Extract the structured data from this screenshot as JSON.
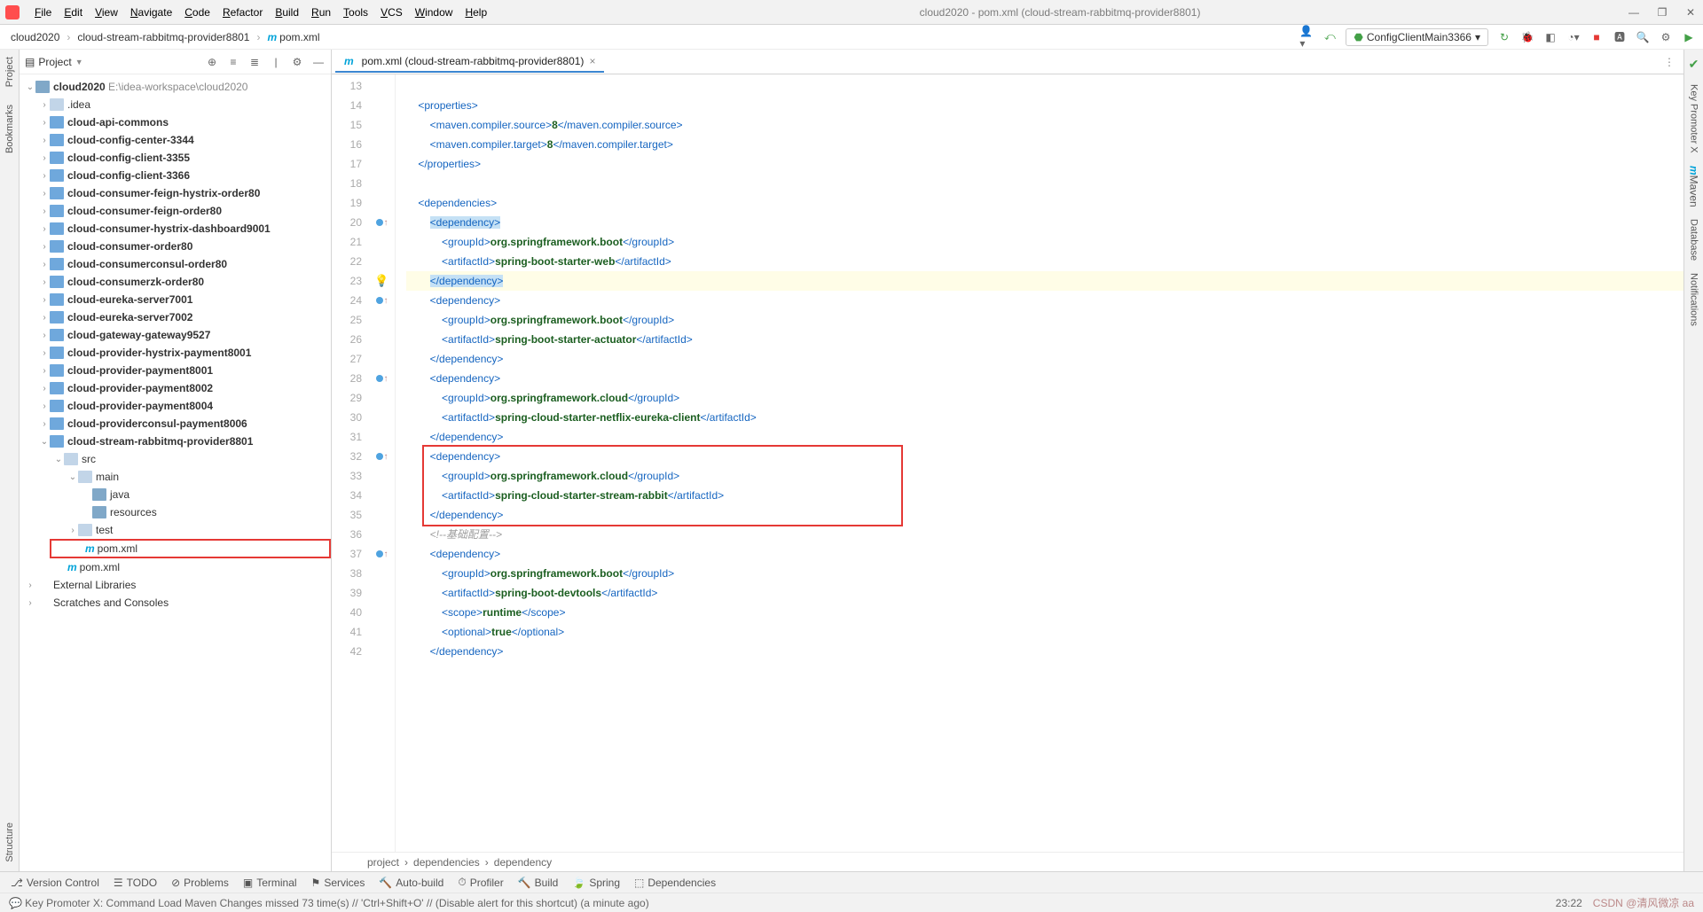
{
  "window": {
    "title": "cloud2020 - pom.xml (cloud-stream-rabbitmq-provider8801)"
  },
  "menu": [
    "File",
    "Edit",
    "View",
    "Navigate",
    "Code",
    "Refactor",
    "Build",
    "Run",
    "Tools",
    "VCS",
    "Window",
    "Help"
  ],
  "crumbs": [
    "cloud2020",
    "cloud-stream-rabbitmq-provider8801",
    "pom.xml"
  ],
  "run_config": "ConfigClientMain3366",
  "proj_header": "Project",
  "tree": {
    "root_name": "cloud2020",
    "root_path": "E:\\idea-workspace\\cloud2020",
    "idea_folder": ".idea",
    "modules": [
      "cloud-api-commons",
      "cloud-config-center-3344",
      "cloud-config-client-3355",
      "cloud-config-client-3366",
      "cloud-consumer-feign-hystrix-order80",
      "cloud-consumer-feign-order80",
      "cloud-consumer-hystrix-dashboard9001",
      "cloud-consumer-order80",
      "cloud-consumerconsul-order80",
      "cloud-consumerzk-order80",
      "cloud-eureka-server7001",
      "cloud-eureka-server7002",
      "cloud-gateway-gateway9527",
      "cloud-provider-hystrix-payment8001",
      "cloud-provider-payment8001",
      "cloud-provider-payment8002",
      "cloud-provider-payment8004",
      "cloud-providerconsul-payment8006"
    ],
    "open_module": "cloud-stream-rabbitmq-provider8801",
    "src": "src",
    "main": "main",
    "java": "java",
    "resources": "resources",
    "test": "test",
    "pom": "pom.xml",
    "root_pom": "pom.xml",
    "ext_lib": "External Libraries",
    "scratches": "Scratches and Consoles"
  },
  "tab": {
    "label": "pom.xml (cloud-stream-rabbitmq-provider8801)"
  },
  "lines": {
    "start": 13,
    "rows": [
      {
        "n": "13",
        "html": ""
      },
      {
        "n": "14",
        "html": "    <span class='tag'>&lt;properties&gt;</span>"
      },
      {
        "n": "15",
        "html": "        <span class='tag'>&lt;maven.compiler.source&gt;</span><span class='txt'>8</span><span class='tag'>&lt;/maven.compiler.source&gt;</span>"
      },
      {
        "n": "16",
        "html": "        <span class='tag'>&lt;maven.compiler.target&gt;</span><span class='txt'>8</span><span class='tag'>&lt;/maven.compiler.target&gt;</span>"
      },
      {
        "n": "17",
        "html": "    <span class='tag'>&lt;/properties&gt;</span>"
      },
      {
        "n": "18",
        "html": ""
      },
      {
        "n": "19",
        "html": "    <span class='tag'>&lt;dependencies&gt;</span>"
      },
      {
        "n": "20",
        "html": "        <span class='tag hl-sel'>&lt;dependency&gt;</span>",
        "mark": "cu"
      },
      {
        "n": "21",
        "html": "            <span class='tag'>&lt;groupId&gt;</span><span class='txt'>org.springframework.boot</span><span class='tag'>&lt;/groupId&gt;</span>"
      },
      {
        "n": "22",
        "html": "            <span class='tag'>&lt;artifactId&gt;</span><span class='txt'>spring-boot-starter-web</span><span class='tag'>&lt;/artifactId&gt;</span>"
      },
      {
        "n": "23",
        "html": "        <span class='tag hl-sel'>&lt;/dependency&gt;</span>",
        "hl": true,
        "mark": "bulb"
      },
      {
        "n": "24",
        "html": "        <span class='tag'>&lt;dependency&gt;</span>",
        "mark": "cu"
      },
      {
        "n": "25",
        "html": "            <span class='tag'>&lt;groupId&gt;</span><span class='txt'>org.springframework.boot</span><span class='tag'>&lt;/groupId&gt;</span>"
      },
      {
        "n": "26",
        "html": "            <span class='tag'>&lt;artifactId&gt;</span><span class='txt'>spring-boot-starter-actuator</span><span class='tag'>&lt;/artifactId&gt;</span>"
      },
      {
        "n": "27",
        "html": "        <span class='tag'>&lt;/dependency&gt;</span>"
      },
      {
        "n": "28",
        "html": "        <span class='tag'>&lt;dependency&gt;</span>",
        "mark": "cu"
      },
      {
        "n": "29",
        "html": "            <span class='tag'>&lt;groupId&gt;</span><span class='txt'>org.springframework.cloud</span><span class='tag'>&lt;/groupId&gt;</span>"
      },
      {
        "n": "30",
        "html": "            <span class='tag'>&lt;artifactId&gt;</span><span class='txt'>spring-cloud-starter-netflix-eureka-client</span><span class='tag'>&lt;/artifactId&gt;</span>"
      },
      {
        "n": "31",
        "html": "        <span class='tag'>&lt;/dependency&gt;</span>"
      },
      {
        "n": "32",
        "html": "        <span class='tag'>&lt;dependency&gt;</span>",
        "mark": "cu"
      },
      {
        "n": "33",
        "html": "            <span class='tag'>&lt;groupId&gt;</span><span class='txt'>org.springframework.cloud</span><span class='tag'>&lt;/groupId&gt;</span>"
      },
      {
        "n": "34",
        "html": "            <span class='tag'>&lt;artifactId&gt;</span><span class='txt'>spring-cloud-starter-stream-rabbit</span><span class='tag'>&lt;/artifactId&gt;</span>"
      },
      {
        "n": "35",
        "html": "        <span class='tag'>&lt;/dependency&gt;</span>"
      },
      {
        "n": "36",
        "html": "        <span class='cmt'>&lt;!--基础配置--&gt;</span>"
      },
      {
        "n": "37",
        "html": "        <span class='tag'>&lt;dependency&gt;</span>",
        "mark": "cu"
      },
      {
        "n": "38",
        "html": "            <span class='tag'>&lt;groupId&gt;</span><span class='txt'>org.springframework.boot</span><span class='tag'>&lt;/groupId&gt;</span>"
      },
      {
        "n": "39",
        "html": "            <span class='tag'>&lt;artifactId&gt;</span><span class='txt'>spring-boot-devtools</span><span class='tag'>&lt;/artifactId&gt;</span>"
      },
      {
        "n": "40",
        "html": "            <span class='tag'>&lt;scope&gt;</span><span class='txt'>runtime</span><span class='tag'>&lt;/scope&gt;</span>"
      },
      {
        "n": "41",
        "html": "            <span class='tag'>&lt;optional&gt;</span><span class='txt'>true</span><span class='tag'>&lt;/optional&gt;</span>"
      },
      {
        "n": "42",
        "html": "        <span class='tag'>&lt;/dependency&gt;</span>"
      }
    ]
  },
  "editor_crumbs": [
    "project",
    "dependencies",
    "dependency"
  ],
  "bottom_tools": [
    "Version Control",
    "TODO",
    "Problems",
    "Terminal",
    "Services",
    "Auto-build",
    "Profiler",
    "Build",
    "Spring",
    "Dependencies"
  ],
  "status": {
    "msg": "Key Promoter X: Command Load Maven Changes missed 73 time(s) // 'Ctrl+Shift+O' // (Disable alert for this shortcut) (a minute ago)",
    "time": "23:22"
  },
  "right_labels": [
    "Key Promoter X",
    "Maven",
    "Database",
    "Notifications"
  ]
}
